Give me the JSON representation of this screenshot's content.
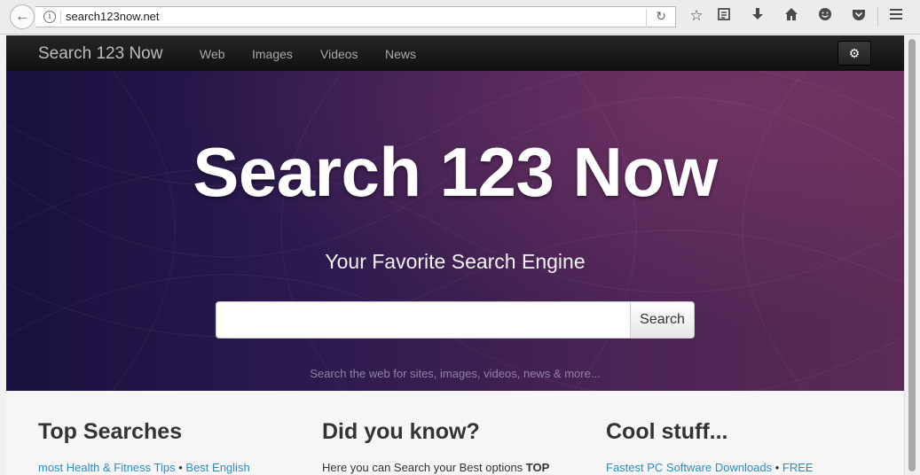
{
  "browser": {
    "url": "search123now.net",
    "toolbar_icons": [
      "star-icon",
      "reading-list-icon",
      "download-icon",
      "home-icon",
      "hello-icon",
      "pocket-icon",
      "menu-icon"
    ]
  },
  "navbar": {
    "brand": "Search 123 Now",
    "links": [
      "Web",
      "Images",
      "Videos",
      "News"
    ],
    "settings_icon": "gear-icon"
  },
  "hero": {
    "title": "Search 123 Now",
    "subtitle": "Your Favorite Search Engine",
    "search_value": "",
    "search_button": "Search",
    "hint": "Search the web for sites, images, videos, news & more..."
  },
  "columns": [
    {
      "title": "Top Searches",
      "text_parts": [
        "most Health & Fitness Tips",
        " • ",
        "Best English"
      ]
    },
    {
      "title": "Did you know?",
      "text_parts": [
        "Here you can Search your Best options ",
        "TOP"
      ]
    },
    {
      "title": "Cool stuff...",
      "text_parts": [
        "Fastest PC Software Downloads",
        " • ",
        "FREE"
      ]
    }
  ],
  "colors": {
    "link": "#2a8cc4",
    "navbar": "#1b1b1b",
    "hero_left": "#18103f",
    "hero_right": "#5a2b55"
  }
}
